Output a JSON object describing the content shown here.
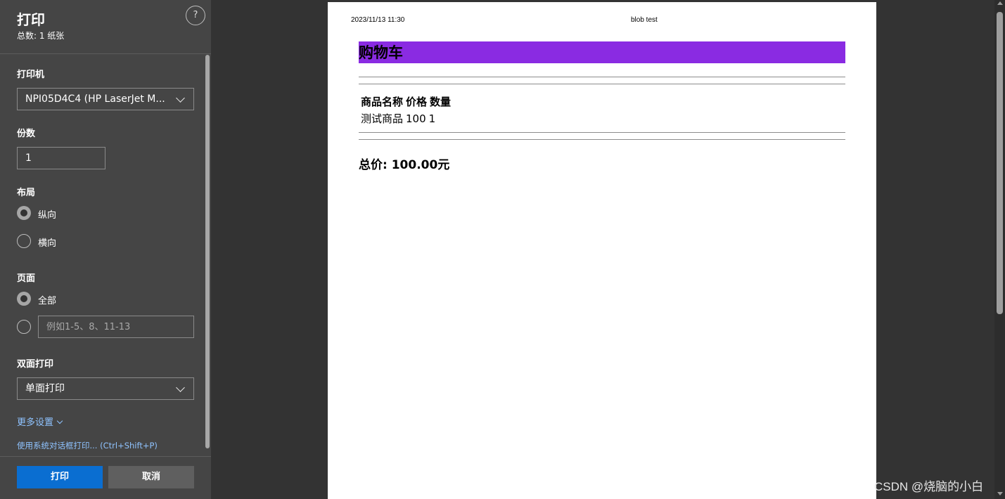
{
  "panel": {
    "title": "打印",
    "subtitle": "总数: 1 纸张",
    "help_label": "?",
    "printer": {
      "label": "打印机",
      "value": "NPI05D4C4 (HP LaserJet M..."
    },
    "copies": {
      "label": "份数",
      "value": "1"
    },
    "layout": {
      "label": "布局",
      "options": [
        {
          "label": "纵向",
          "checked": true
        },
        {
          "label": "横向",
          "checked": false
        }
      ]
    },
    "pages": {
      "label": "页面",
      "options": [
        {
          "label": "全部",
          "checked": true
        },
        {
          "label": "",
          "checked": false
        }
      ],
      "custom_placeholder": "例如1-5、8、11-13"
    },
    "duplex": {
      "label": "双面打印",
      "value": "单面打印"
    },
    "more_settings": "更多设置",
    "system_dialog": "使用系统对话框打印... (Ctrl+Shift+P)",
    "print_button": "打印",
    "cancel_button": "取消"
  },
  "preview": {
    "header_date": "2023/11/13 11:30",
    "header_title": "blob test",
    "cart_title": "购物车",
    "title_bar_color": "#8a2be2",
    "table": {
      "headers": [
        "商品名称",
        "价格",
        "数量"
      ],
      "rows": [
        [
          "测试商品",
          "100",
          "1"
        ]
      ]
    },
    "total": "总价: 100.00元"
  },
  "watermark": "CSDN @烧脑的小白"
}
